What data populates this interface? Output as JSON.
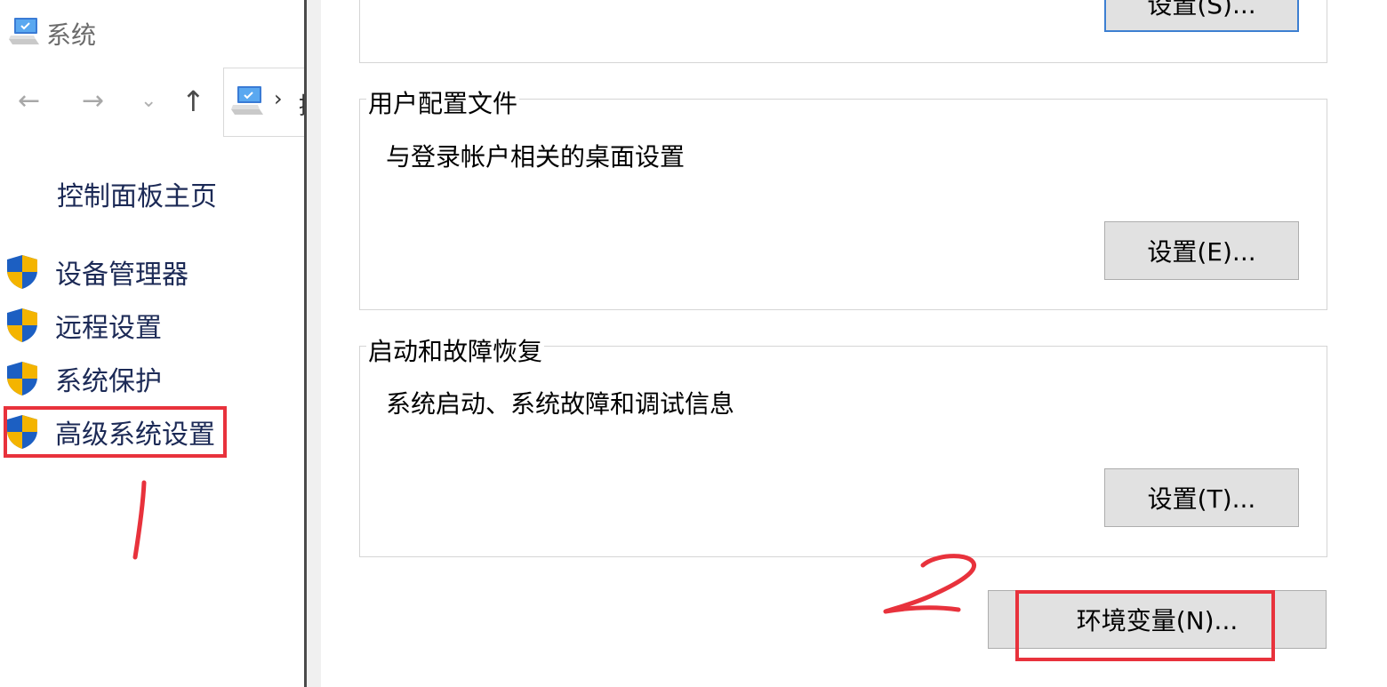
{
  "window": {
    "title": "系统"
  },
  "navigation": {
    "back_icon": "arrow-left",
    "forward_icon": "arrow-right",
    "recent_icon": "chevron-down",
    "up_icon": "arrow-up",
    "address_separator": "›",
    "address_partial_text": "控"
  },
  "sidebar": {
    "home_link": "控制面板主页",
    "items": [
      {
        "label": "设备管理器",
        "icon": "uac-shield"
      },
      {
        "label": "远程设置",
        "icon": "uac-shield"
      },
      {
        "label": "系统保护",
        "icon": "uac-shield"
      },
      {
        "label": "高级系统设置",
        "icon": "uac-shield"
      }
    ]
  },
  "dialog": {
    "performance": {
      "settings_button": "设置(S)..."
    },
    "user_profiles": {
      "title": "用户配置文件",
      "description": "与登录帐户相关的桌面设置",
      "settings_button": "设置(E)..."
    },
    "startup_recovery": {
      "title": "启动和故障恢复",
      "description": "系统启动、系统故障和调试信息",
      "settings_button": "设置(T)..."
    },
    "environment_variables_button": "环境变量(N)..."
  },
  "annotations": {
    "highlight_color": "#e8323c"
  }
}
